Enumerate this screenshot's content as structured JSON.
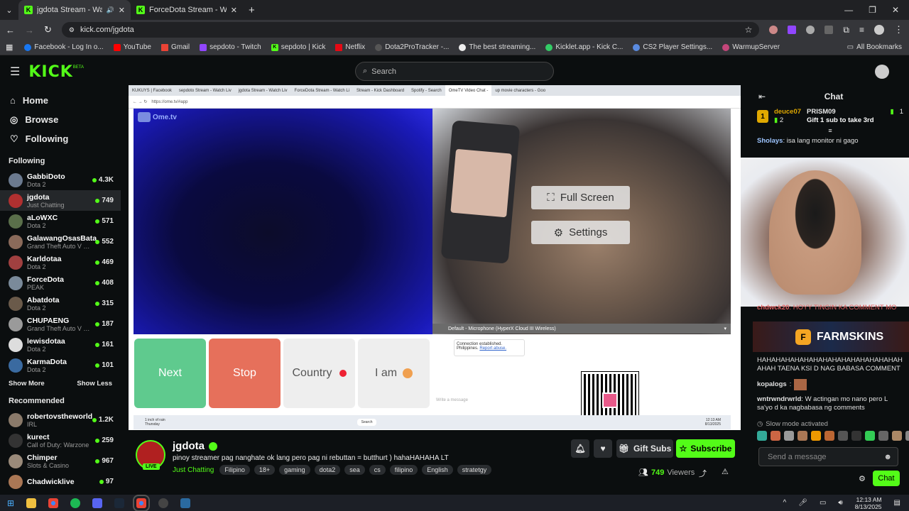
{
  "browser": {
    "tabs": [
      {
        "title": "jgdota Stream - Watch Live",
        "active": true
      },
      {
        "title": "ForceDota Stream - Watch Live",
        "active": false
      }
    ],
    "url": "kick.com/jgdota",
    "bookmarks": [
      "Facebook - Log In o...",
      "YouTube",
      "Gmail",
      "sepdoto - Twitch",
      "sepdoto | Kick",
      "Netflix",
      "Dota2ProTracker -...",
      "The best streaming...",
      "Kicklet.app - Kick C...",
      "CS2 Player Settings...",
      "WarmupServer"
    ],
    "all_bookmarks": "All Bookmarks"
  },
  "header": {
    "logo": "KICK",
    "search_placeholder": "Search"
  },
  "sidebar": {
    "nav": [
      {
        "label": "Home",
        "icon": "home-icon"
      },
      {
        "label": "Browse",
        "icon": "compass-icon"
      },
      {
        "label": "Following",
        "icon": "heart-icon"
      }
    ],
    "following_title": "Following",
    "following": [
      {
        "name": "GabbiDoto",
        "game": "Dota 2",
        "viewers": "4.3K",
        "color": "#6b7a8f"
      },
      {
        "name": "jgdota",
        "game": "Just Chatting",
        "viewers": "749",
        "color": "#b03030"
      },
      {
        "name": "aLoWXC",
        "game": "Dota 2",
        "viewers": "571",
        "color": "#5a6f4a"
      },
      {
        "name": "GalawangOsasBata",
        "game": "Grand Theft Auto V (G...",
        "viewers": "552",
        "color": "#8a6a5a"
      },
      {
        "name": "Karldotaa",
        "game": "Dota 2",
        "viewers": "469",
        "color": "#a04040"
      },
      {
        "name": "ForceDota",
        "game": "PEAK",
        "viewers": "408",
        "color": "#7a8a9a"
      },
      {
        "name": "Abatdota",
        "game": "Dota 2",
        "viewers": "315",
        "color": "#6a5a4a"
      },
      {
        "name": "CHUPAENG",
        "game": "Grand Theft Auto V (G...",
        "viewers": "187",
        "color": "#9a9a9a"
      },
      {
        "name": "lewisdotaa",
        "game": "Dota 2",
        "viewers": "161",
        "color": "#dddddd"
      },
      {
        "name": "KarmaDota",
        "game": "Dota 2",
        "viewers": "101",
        "color": "#3a6aa0"
      }
    ],
    "show_more": "Show More",
    "show_less": "Show Less",
    "recommended_title": "Recommended",
    "recommended": [
      {
        "name": "robertovstheworld",
        "game": "IRL",
        "viewers": "1.2K",
        "color": "#8a7a6a"
      },
      {
        "name": "kurect",
        "game": "Call of Duty: Warzone",
        "viewers": "259",
        "color": "#333333"
      },
      {
        "name": "Chimper",
        "game": "Slots & Casino",
        "viewers": "967",
        "color": "#9a8a7a"
      },
      {
        "name": "Chadwicklive",
        "game": "",
        "viewers": "97",
        "color": "#aa7755"
      }
    ]
  },
  "video": {
    "inner_tabs": [
      "KUKUYS | Facebook",
      "sepdoto Stream - Watch Liv",
      "jgdota Stream - Watch Liv",
      "ForceDota Stream - Watch Li",
      "Stream - Kick Dashboard",
      "Spotify - Search",
      "OmeTV Video Chat -",
      "up movie characters - Goo"
    ],
    "inner_url": "https://ome.tv/#app",
    "ome_logo": "Ome.tv",
    "full_screen": "Full Screen",
    "settings": "Settings",
    "microphone": "Default - Microphone (HyperX Cloud III Wireless)",
    "buttons": {
      "next": "Next",
      "stop": "Stop",
      "country": "Country",
      "i_am": "I am"
    },
    "connection": "Connection established.",
    "country_line": "Philippines.",
    "report": "Report abuse.",
    "write_placeholder": "Write a message",
    "weather": "1 inch of rain",
    "weather_day": "Thursday",
    "inner_search": "Search",
    "inner_time": "12:13 AM",
    "inner_date": "8/13/2025"
  },
  "stream": {
    "name": "jgdota",
    "live": "LIVE",
    "title": "pinoy streamer pag nanghate ok lang pero pag ni rebuttan = butthurt ) hahaHAHAHA LT",
    "category": "Just Chatting",
    "tags": [
      "Filipino",
      "18+",
      "gaming",
      "dota2",
      "sea",
      "cs",
      "filipino",
      "English",
      "stratetgy"
    ],
    "viewers": "749",
    "viewers_label": "Viewers",
    "gift_subs": "Gift Subs",
    "subscribe": "Subscribe"
  },
  "chat": {
    "title": "Chat",
    "top_gifters": [
      {
        "name": "deuce07",
        "count": "2"
      },
      {
        "name": "PRISM09",
        "count": "1"
      }
    ],
    "gift_line": "Gift 1 sub to take 3rd",
    "messages_top": [
      {
        "user": "Sholays",
        "text": "isa lang monitor ni gago",
        "color": "#9ec5ff"
      }
    ],
    "partial_user": "chdwck20",
    "partial_text": "HOYY TINGIN KA COMMENT MO",
    "farmskins": "FARMSKINS",
    "laugh_text": "HAHAHAHAHAHAHAHAHAHAHAHAHAHAHAH AHAH TAENA KSI D NAG BABASA COMMENT",
    "messages_bottom": [
      {
        "user": "kopalogs",
        "text": "",
        "color": "#ffffff"
      },
      {
        "user": "wntrwndrwrld",
        "text": "W actingan mo nano pero L sa'yo d ka nagbabasa ng comments",
        "color": "#ffffff"
      }
    ],
    "slow_mode": "Slow mode activated",
    "send_placeholder": "Send a message",
    "chat_button": "Chat"
  },
  "taskbar": {
    "time": "12:13 AM",
    "date": "8/13/2025"
  }
}
